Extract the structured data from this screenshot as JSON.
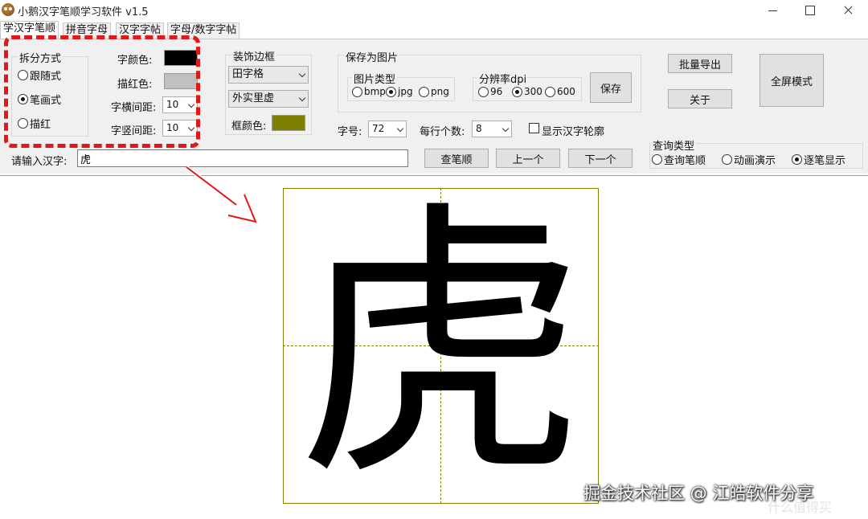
{
  "window": {
    "title": "小鹅汉字笔顺学习软件 v1.5"
  },
  "tabs": [
    "学汉字笔顺",
    "拼音字母",
    "汉字字帖",
    "字母/数字字帖"
  ],
  "split": {
    "group_label": "拆分方式",
    "options": [
      "跟随式",
      "笔画式",
      "描红"
    ],
    "selected": "笔画式"
  },
  "colors": {
    "char_color_label": "字颜色:",
    "char_color": "#000000",
    "trace_color_label": "描红色:",
    "trace_color": "#c0c0c0",
    "frame_color_label": "框颜色:",
    "frame_color": "#808000",
    "accent_highlight": "#e01818"
  },
  "spacing": {
    "h_label": "字横间距:",
    "h_value": "10",
    "v_label": "字竖间距:",
    "v_value": "10"
  },
  "decor": {
    "group_label": "装饰边框",
    "grid_style": "田字格",
    "line_style": "外实里虚"
  },
  "save": {
    "group_label": "保存为图片",
    "type_label": "图片类型",
    "types": [
      "bmp",
      "jpg",
      "png"
    ],
    "type_selected": "jpg",
    "dpi_label": "分辨率dpi",
    "dpis": [
      "96",
      "300",
      "600"
    ],
    "dpi_selected": "300",
    "save_button": "保存"
  },
  "font_size": {
    "label": "字号:",
    "value": "72"
  },
  "per_row": {
    "label": "每行个数:",
    "value": "8"
  },
  "outline": {
    "label": "显示汉字轮廓",
    "checked": false
  },
  "buttons": {
    "batch_export": "批量导出",
    "about": "关于",
    "fullscreen": "全屏模式",
    "query_stroke": "查笔顺",
    "prev": "上一个",
    "next": "下一个"
  },
  "input": {
    "label": "请输入汉字:",
    "value": "虎"
  },
  "query_type": {
    "group_label": "查询类型",
    "options": [
      "查询笔顺",
      "动画演示",
      "逐笔显示"
    ],
    "selected": "逐笔显示"
  },
  "display": {
    "character": "虎"
  },
  "watermark": {
    "text": "掘金技术社区 @ 江皓软件分享",
    "corner": "什么值得买"
  }
}
